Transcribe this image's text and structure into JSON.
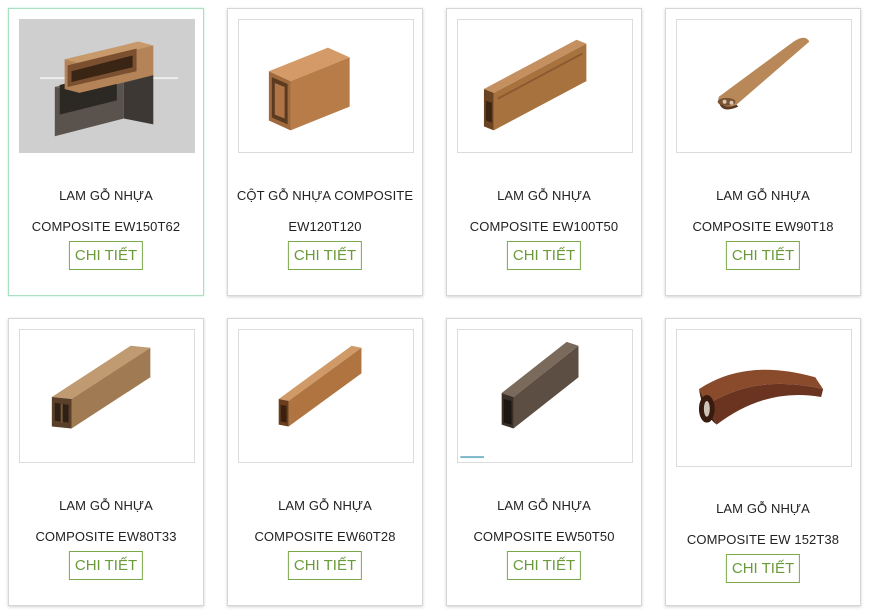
{
  "products": [
    {
      "line1": "LAM GỖ NHỰA",
      "line2": "COMPOSITE EW150T62",
      "button": "CHI TIẾT",
      "image_icon": "hollow-profile-stack"
    },
    {
      "line1": "CỘT GỖ NHỰA COMPOSITE",
      "line2": "EW120T120",
      "button": "CHI TIẾT",
      "image_icon": "square-column"
    },
    {
      "line1": "LAM GỖ NHỰA",
      "line2": "COMPOSITE EW100T50",
      "button": "CHI TIẾT",
      "image_icon": "rectangular-profile"
    },
    {
      "line1": "LAM GỖ NHỰA",
      "line2": "COMPOSITE EW90T18",
      "button": "CHI TIẾT",
      "image_icon": "thin-oval-profile"
    },
    {
      "line1": "LAM GỖ NHỰA",
      "line2": "COMPOSITE EW80T33",
      "button": "CHI TIẾT",
      "image_icon": "flat-rectangular-profile"
    },
    {
      "line1": "LAM GỖ NHỰA",
      "line2": "COMPOSITE EW60T28",
      "button": "CHI TIẾT",
      "image_icon": "small-rectangular-profile"
    },
    {
      "line1": "LAM GỖ NHỰA",
      "line2": "COMPOSITE EW50T50",
      "button": "CHI TIẾT",
      "image_icon": "dark-square-profile"
    },
    {
      "line1": "LAM GỖ NHỰA",
      "line2": "COMPOSITE EW 152T38",
      "button": "CHI TIẾT",
      "image_icon": "curved-oval-profile"
    }
  ],
  "colors": {
    "button_border": "#7aa84a",
    "button_text": "#6b9a3a",
    "active_border": "#a8e0c0",
    "wood_light": "#b07a48",
    "wood_dark": "#6e5a4a"
  }
}
